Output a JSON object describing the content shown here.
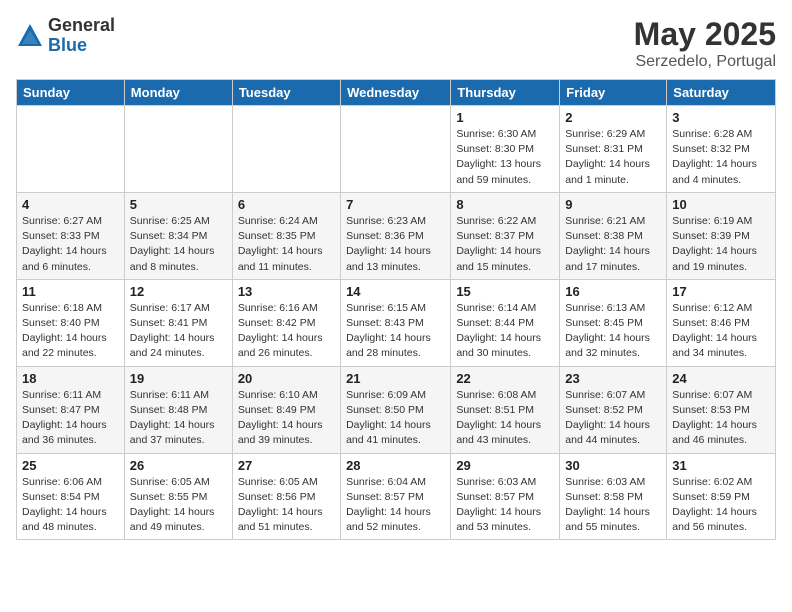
{
  "logo": {
    "general": "General",
    "blue": "Blue"
  },
  "title": {
    "month": "May 2025",
    "location": "Serzedelo, Portugal"
  },
  "weekdays": [
    "Sunday",
    "Monday",
    "Tuesday",
    "Wednesday",
    "Thursday",
    "Friday",
    "Saturday"
  ],
  "weeks": [
    [
      {
        "day": "",
        "info": ""
      },
      {
        "day": "",
        "info": ""
      },
      {
        "day": "",
        "info": ""
      },
      {
        "day": "",
        "info": ""
      },
      {
        "day": "1",
        "info": "Sunrise: 6:30 AM\nSunset: 8:30 PM\nDaylight: 13 hours and 59 minutes."
      },
      {
        "day": "2",
        "info": "Sunrise: 6:29 AM\nSunset: 8:31 PM\nDaylight: 14 hours and 1 minute."
      },
      {
        "day": "3",
        "info": "Sunrise: 6:28 AM\nSunset: 8:32 PM\nDaylight: 14 hours and 4 minutes."
      }
    ],
    [
      {
        "day": "4",
        "info": "Sunrise: 6:27 AM\nSunset: 8:33 PM\nDaylight: 14 hours and 6 minutes."
      },
      {
        "day": "5",
        "info": "Sunrise: 6:25 AM\nSunset: 8:34 PM\nDaylight: 14 hours and 8 minutes."
      },
      {
        "day": "6",
        "info": "Sunrise: 6:24 AM\nSunset: 8:35 PM\nDaylight: 14 hours and 11 minutes."
      },
      {
        "day": "7",
        "info": "Sunrise: 6:23 AM\nSunset: 8:36 PM\nDaylight: 14 hours and 13 minutes."
      },
      {
        "day": "8",
        "info": "Sunrise: 6:22 AM\nSunset: 8:37 PM\nDaylight: 14 hours and 15 minutes."
      },
      {
        "day": "9",
        "info": "Sunrise: 6:21 AM\nSunset: 8:38 PM\nDaylight: 14 hours and 17 minutes."
      },
      {
        "day": "10",
        "info": "Sunrise: 6:19 AM\nSunset: 8:39 PM\nDaylight: 14 hours and 19 minutes."
      }
    ],
    [
      {
        "day": "11",
        "info": "Sunrise: 6:18 AM\nSunset: 8:40 PM\nDaylight: 14 hours and 22 minutes."
      },
      {
        "day": "12",
        "info": "Sunrise: 6:17 AM\nSunset: 8:41 PM\nDaylight: 14 hours and 24 minutes."
      },
      {
        "day": "13",
        "info": "Sunrise: 6:16 AM\nSunset: 8:42 PM\nDaylight: 14 hours and 26 minutes."
      },
      {
        "day": "14",
        "info": "Sunrise: 6:15 AM\nSunset: 8:43 PM\nDaylight: 14 hours and 28 minutes."
      },
      {
        "day": "15",
        "info": "Sunrise: 6:14 AM\nSunset: 8:44 PM\nDaylight: 14 hours and 30 minutes."
      },
      {
        "day": "16",
        "info": "Sunrise: 6:13 AM\nSunset: 8:45 PM\nDaylight: 14 hours and 32 minutes."
      },
      {
        "day": "17",
        "info": "Sunrise: 6:12 AM\nSunset: 8:46 PM\nDaylight: 14 hours and 34 minutes."
      }
    ],
    [
      {
        "day": "18",
        "info": "Sunrise: 6:11 AM\nSunset: 8:47 PM\nDaylight: 14 hours and 36 minutes."
      },
      {
        "day": "19",
        "info": "Sunrise: 6:11 AM\nSunset: 8:48 PM\nDaylight: 14 hours and 37 minutes."
      },
      {
        "day": "20",
        "info": "Sunrise: 6:10 AM\nSunset: 8:49 PM\nDaylight: 14 hours and 39 minutes."
      },
      {
        "day": "21",
        "info": "Sunrise: 6:09 AM\nSunset: 8:50 PM\nDaylight: 14 hours and 41 minutes."
      },
      {
        "day": "22",
        "info": "Sunrise: 6:08 AM\nSunset: 8:51 PM\nDaylight: 14 hours and 43 minutes."
      },
      {
        "day": "23",
        "info": "Sunrise: 6:07 AM\nSunset: 8:52 PM\nDaylight: 14 hours and 44 minutes."
      },
      {
        "day": "24",
        "info": "Sunrise: 6:07 AM\nSunset: 8:53 PM\nDaylight: 14 hours and 46 minutes."
      }
    ],
    [
      {
        "day": "25",
        "info": "Sunrise: 6:06 AM\nSunset: 8:54 PM\nDaylight: 14 hours and 48 minutes."
      },
      {
        "day": "26",
        "info": "Sunrise: 6:05 AM\nSunset: 8:55 PM\nDaylight: 14 hours and 49 minutes."
      },
      {
        "day": "27",
        "info": "Sunrise: 6:05 AM\nSunset: 8:56 PM\nDaylight: 14 hours and 51 minutes."
      },
      {
        "day": "28",
        "info": "Sunrise: 6:04 AM\nSunset: 8:57 PM\nDaylight: 14 hours and 52 minutes."
      },
      {
        "day": "29",
        "info": "Sunrise: 6:03 AM\nSunset: 8:57 PM\nDaylight: 14 hours and 53 minutes."
      },
      {
        "day": "30",
        "info": "Sunrise: 6:03 AM\nSunset: 8:58 PM\nDaylight: 14 hours and 55 minutes."
      },
      {
        "day": "31",
        "info": "Sunrise: 6:02 AM\nSunset: 8:59 PM\nDaylight: 14 hours and 56 minutes."
      }
    ]
  ]
}
